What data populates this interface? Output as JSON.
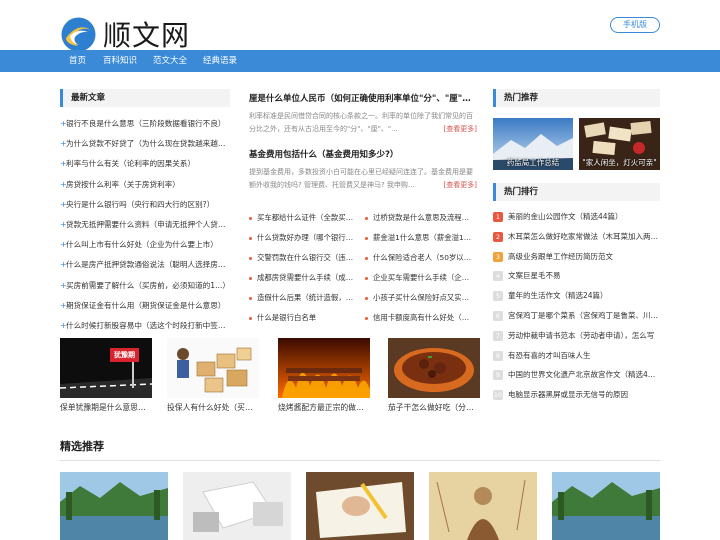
{
  "header": {
    "logo_text": "顺文网",
    "mobile_label": "手机版"
  },
  "nav": {
    "items": [
      "首页",
      "百科知识",
      "范文大全",
      "经典语录"
    ]
  },
  "latest": {
    "title": "最新文章",
    "items": [
      "银行不良是什么意思（三阶段数据看银行不良）",
      "为什么贷款不好贷了（为什么现在贷款越来越难）",
      "利率与什么有关（论利率的因果关系）",
      "房贷按什么利率（关于房贷利率）",
      "央行是什么银行吗（央行和四大行的区别?）",
      "贷款无抵押需要什么资料（申请无抵押个人贷款）",
      "什么叫上市有什么好处（企业为什么要上市）",
      "什么是房产抵押贷款通俗说法（聪明人选择房产抵押）",
      "买房前需要了解什么（买房前，必须知道的1...）",
      "期货保证金有什么用（期货保证金是什么意思）",
      "什么时候打新股容易中（选这个时段打新中签率高）"
    ]
  },
  "features": [
    {
      "title": "厘是什么单位人民币（如何正确使用利率单位\"分\"、\"厘\"、...",
      "desc": "利率标准是民间借贷合同的核心条款之一。利率的单位除了我们常见的百分比之外，还有从古沿用至今的\"分\"、\"厘\"、\"...",
      "more": "[查看更多]"
    },
    {
      "title": "基金费用包括什么（基金费用知多少?）",
      "desc": "提到基金费用，多数投资小白可能在心里已经疑问连连了。基金费用是要额外收我的钱吗? 管理费、托管费又是神马? 我申购...",
      "more": "[查看更多]"
    }
  ],
  "mid_list_left": [
    "买车都给什么证件（全款买车需要什么手续）",
    "什么贷款好办理（哪个银行贷款最好办）",
    "交警罚款在什么银行交（违章罚款在哪交）",
    "成都房贷需要什么手续（成都房贷办理流程）",
    "造假什么后果（统计造假，后果严重）",
    "什么是银行白名单"
  ],
  "mid_list_right": [
    "过桥贷款是什么意思及流程（过桥贷款）",
    "薪金溢1什么意思（薪金溢1是什么）",
    "什么保险适合老人（50岁以上买什么保险）",
    "企业买车需要什么手续（企业购车流程）",
    "小孩子买什么保险好点又实惠（少儿保险）",
    "信用卡额度高有什么好处（额度高的好处）"
  ],
  "thumbs": [
    {
      "caption": "保单犹豫期是什么意思（保单犹豫期）",
      "badge": "犹豫期"
    },
    {
      "caption": "投保人有什么好处（买保险的好处）"
    },
    {
      "caption": "烧烤酱配方最正宗的做法（烧烤酱）"
    },
    {
      "caption": "茄子干怎么做好吃（分享茄子干做法）"
    }
  ],
  "hot": {
    "title": "热门推荐",
    "items": [
      "药监局工作总结",
      "\"家人闲坐，灯火可亲\""
    ]
  },
  "rank": {
    "title": "热门排行",
    "items": [
      "美丽的金山公园作文（精选44篇）",
      "木耳菜怎么做好吃家常做法（木耳菜加入两样东西）",
      "高级业务跟单工作经历简历范文",
      "文案巨星毛不易",
      "童年的生活作文（精选24篇）",
      "宫保鸡丁是哪个菜系（宫保鸡丁是鲁菜、川菜）",
      "劳动仲裁申请书范本（劳动者申请），怎么写",
      "有恐有喜的才叫百味人生",
      "中国的世界文化遗产北京故宫作文（精选47篇）",
      "电脑显示器黑屏或显示无信号的原因"
    ]
  },
  "recommend": {
    "title": "精选推荐"
  }
}
